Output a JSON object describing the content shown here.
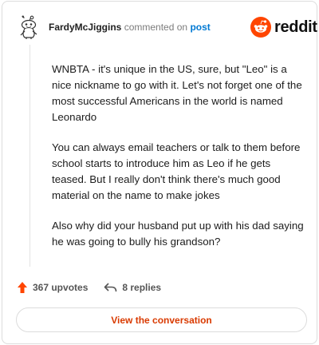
{
  "header": {
    "username": "FardyMcJiggins",
    "action_text": "commented on",
    "post_link": "post"
  },
  "brand": {
    "name": "reddit",
    "accent_color": "#ff4500"
  },
  "comment": {
    "paragraphs": [
      "WNBTA - it's unique in the US, sure, but \"Leo\" is a nice nickname to go with it. Let's not forget one of the most successful Americans in the world is named Leonardo",
      "You can always email teachers or talk to them before school starts to introduce him as Leo if he gets teased. But I really don't think there's much good material on the name to make jokes",
      "Also why did your husband put up with his dad saying he was going to bully his grandson?"
    ]
  },
  "footer": {
    "upvotes_label": "367 upvotes",
    "replies_label": "8 replies",
    "upvote_icon": "upvote-arrow-icon",
    "reply_icon": "reply-arrow-icon"
  },
  "cta": {
    "label": "View the conversation",
    "color": "#d93a00"
  }
}
